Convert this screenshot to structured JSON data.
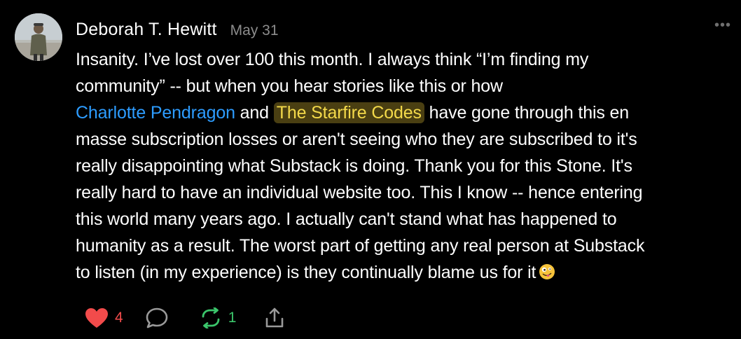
{
  "author": {
    "name": "Deborah T. Hewitt",
    "date": "May 31"
  },
  "more_label": "•••",
  "body": {
    "line1": "Insanity. I’ve lost over 100 this month. I always think “I’m finding my",
    "line2": "community” -- but when you hear stories like this or how",
    "mention1": "Charlotte Pendragon",
    "and_word": " and ",
    "mention2": "The Starfire Codes",
    "line3_rest": " have gone through this en",
    "line4": "masse subscription losses or aren't seeing who they are subscribed to it's",
    "line5": "really disappointing what Substack is doing. Thank you for this Stone. It's",
    "line6": "really hard to have an individual website too. This I know -- hence entering",
    "line7": "this world many years ago. I actually can't stand what has happened to",
    "line8": "humanity as a result. The worst part of getting any real person at Substack",
    "line9": "to listen (in my experience) is they continually blame us for it"
  },
  "actions": {
    "like_count": "4",
    "restack_count": "1"
  },
  "colors": {
    "background": "#000000",
    "mention_link": "#2d9cff",
    "highlight_text": "#f3d94a",
    "highlight_bg": "#4a3f12",
    "like": "#f24b4b",
    "restack": "#3bc56b",
    "muted": "#8c8c8c"
  },
  "icons": {
    "like": "heart-icon",
    "comment": "comment-bubble-icon",
    "restack": "restack-icon",
    "share": "share-icon",
    "emoji": "zany-face-emoji"
  }
}
